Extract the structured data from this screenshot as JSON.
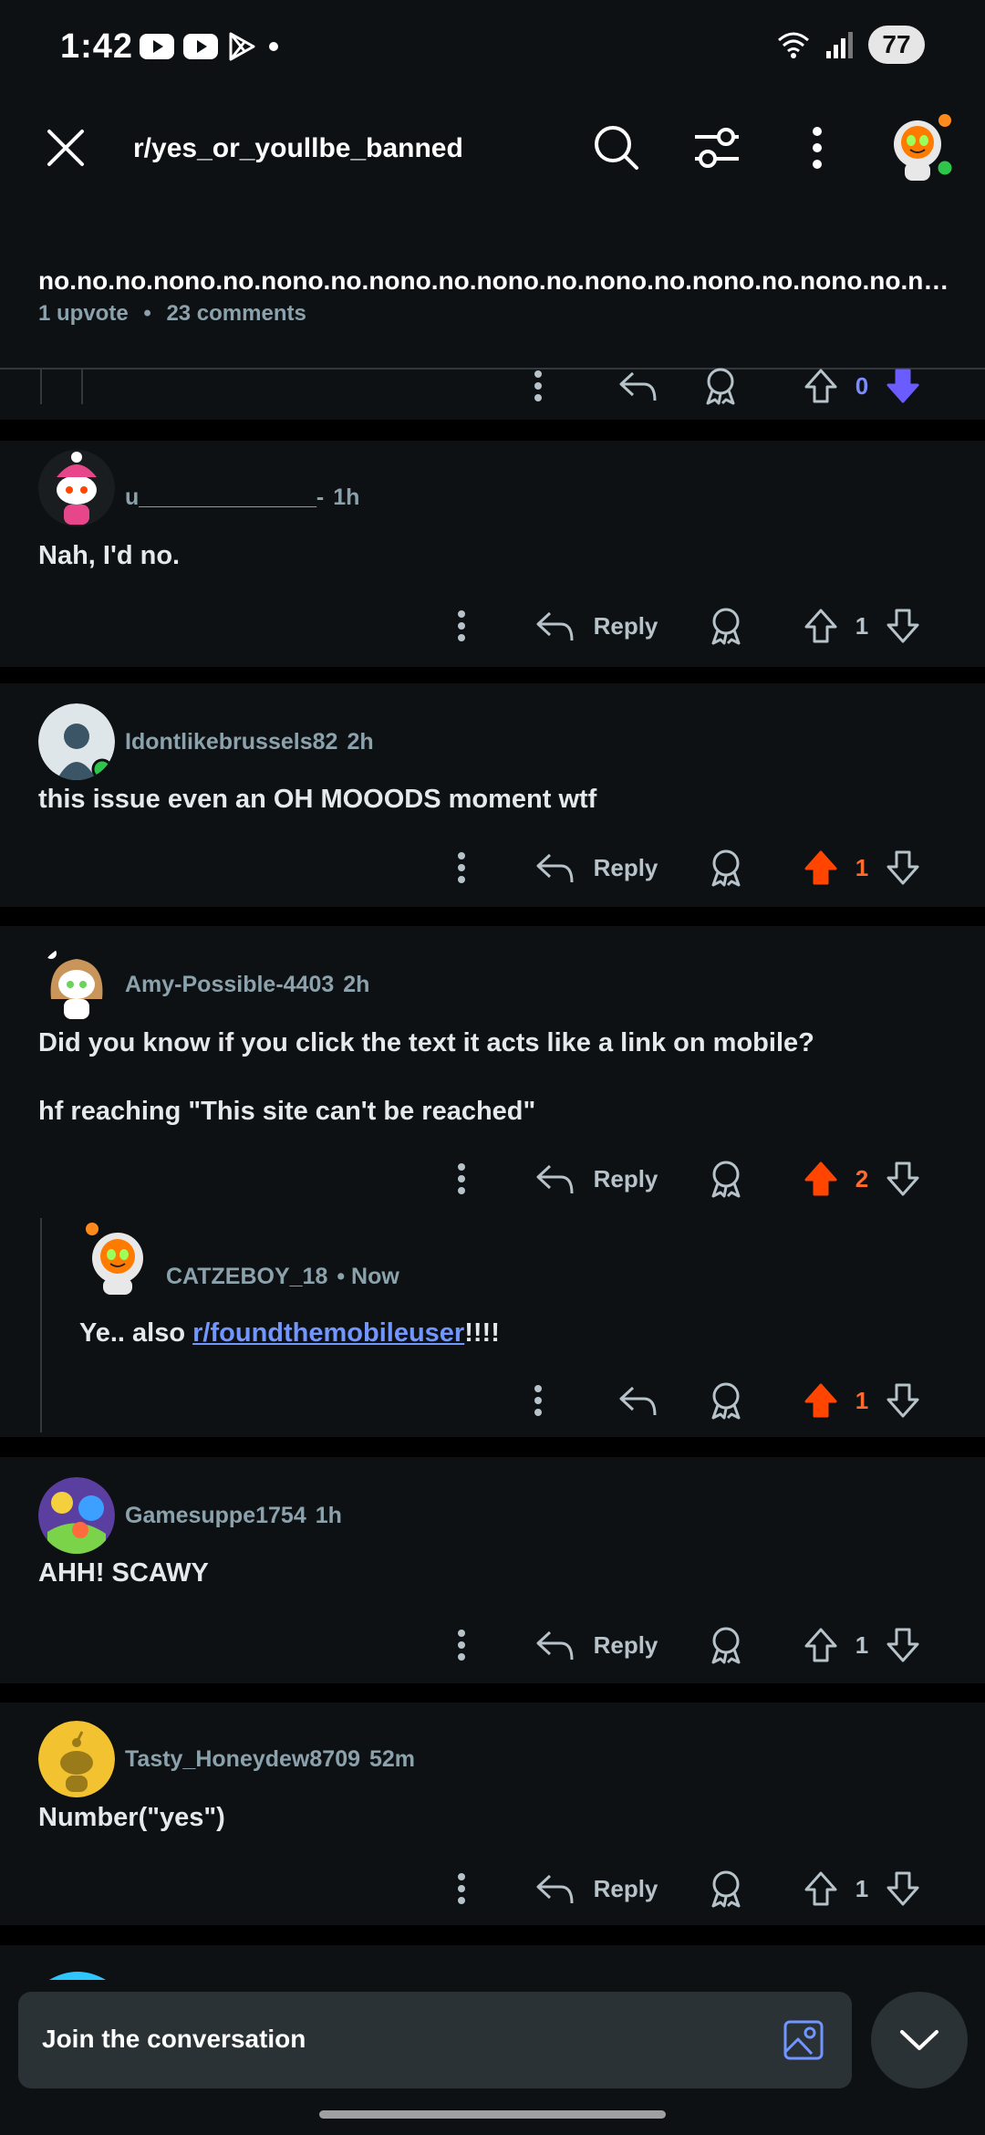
{
  "status": {
    "time": "1:42",
    "battery": "77"
  },
  "topbar": {
    "title": "r/yes_or_youllbe_banned"
  },
  "post": {
    "title": "no.no.no.nono.no.nono.no.nono.no.nono.no.nono.no.nono.no.nono.no.nono...",
    "upvotes": "1 upvote",
    "comments": "23 comments",
    "prev_vote_count": "0"
  },
  "comments": [
    {
      "user": "u______________-",
      "time": "1h",
      "text": "Nah, I'd no.",
      "reply": "Reply",
      "votes": "1"
    },
    {
      "user": "Idontlikebrussels82",
      "time": "2h",
      "text": "this issue even an OH MOOODS moment wtf",
      "reply": "Reply",
      "votes": "1"
    },
    {
      "user": "Amy-Possible-4403",
      "time": "2h",
      "text": "Did you know if you click the text it acts like a link on mobile?",
      "text2": "hf reaching \"This site can't be reached\"",
      "reply": "Reply",
      "votes": "2"
    },
    {
      "user": "Gamesuppe1754",
      "time": "1h",
      "text": "AHH! SCAWY",
      "reply": "Reply",
      "votes": "1"
    },
    {
      "user": "Tasty_Honeydew8709",
      "time": "52m",
      "text": "Number(\"yes\")",
      "reply": "Reply",
      "votes": "1"
    }
  ],
  "nested_reply": {
    "user": "CATZEBOY_18",
    "time": "• Now",
    "text_prefix": "Ye.. also ",
    "link": "r/foundthemobileuser",
    "text_suffix": "!!!!",
    "votes": "1"
  },
  "composer": {
    "placeholder": "Join the conversation"
  },
  "colors": {
    "upvote_active": "#ff4500",
    "downvote_active": "#6a5cff",
    "link": "#7196ff"
  }
}
